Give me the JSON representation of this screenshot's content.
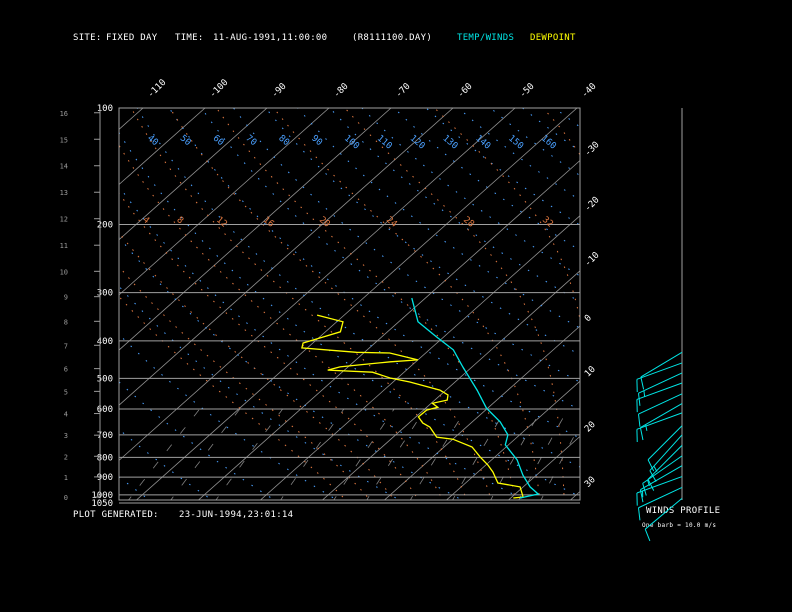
{
  "header": {
    "site_label": "SITE:",
    "site": "FIXED DAY",
    "time_label": "TIME:",
    "time": "11-AUG-1991,11:00:00",
    "file": "(R8111100.DAY)",
    "legend_temp": "TEMP/WINDS",
    "legend_dew": "DEWPOINT"
  },
  "footer": {
    "generated_label": "PLOT GENERATED:",
    "generated": "23-JUN-1994,23:01:14"
  },
  "winds_panel": {
    "title": "WINDS PROFILE",
    "note": "One barb = 10.0 m/s"
  },
  "colors": {
    "background": "#000000",
    "temp": "#00e5e5",
    "dewpoint": "#ffff00",
    "isotherm": "#909090",
    "isobar": "#a0a0a0",
    "dry_adiabat": "#4aa0ff",
    "moist_adiabat": "#e07840",
    "mixing_ratio": "#808080",
    "text": "#ffffff",
    "height_axis": "#9a9a9a"
  },
  "chart_data": {
    "type": "line",
    "diagram": "skew-T log-P",
    "y_scale": "log",
    "ylim_hpa": [
      1050,
      100
    ],
    "pressure_ticks": [
      100,
      200,
      300,
      400,
      500,
      600,
      700,
      800,
      900,
      1000,
      1050
    ],
    "height_ticks_km": [
      0,
      1,
      2,
      3,
      4,
      5,
      6,
      7,
      8,
      9,
      10,
      11,
      12,
      13,
      14,
      15,
      16
    ],
    "isotherm_top_labels": [
      -110,
      -100,
      -90,
      -80,
      -70,
      -60,
      -50,
      -40
    ],
    "isotherm_right_labels": [
      -30,
      -20,
      -10,
      0,
      10,
      20,
      30
    ],
    "dry_adiabat_labels": [
      30,
      40,
      50,
      60,
      70,
      80,
      90,
      100,
      110,
      120,
      130,
      140,
      150,
      160
    ],
    "moist_adiabat_labels": [
      4,
      8,
      12,
      16,
      20,
      24,
      28,
      32
    ],
    "mixing_ratio_lines_gkg": [
      0.1,
      0.2,
      0.4,
      1,
      2,
      3,
      5,
      8,
      12,
      16,
      20
    ],
    "series": [
      {
        "name": "TEMP/WINDS",
        "color": "#00e5e5",
        "points_p_t": [
          [
            310,
            -32.2
          ],
          [
            357,
            -26.9
          ],
          [
            391,
            -21.1
          ],
          [
            422,
            -16.1
          ],
          [
            467,
            -11.5
          ],
          [
            536,
            -5.0
          ],
          [
            597,
            -0.2
          ],
          [
            648,
            4.5
          ],
          [
            700,
            8.1
          ],
          [
            743,
            9.5
          ],
          [
            812,
            14.1
          ],
          [
            889,
            17.8
          ],
          [
            954,
            21.1
          ],
          [
            995,
            23.7
          ],
          [
            1019,
            21.5
          ]
        ]
      },
      {
        "name": "DEWPOINT",
        "color": "#ffff00",
        "points_p_t": [
          [
            343,
            -44.4
          ],
          [
            357,
            -39.0
          ],
          [
            379,
            -37.6
          ],
          [
            391,
            -39.5
          ],
          [
            405,
            -41.6
          ],
          [
            417,
            -40.9
          ],
          [
            428,
            -31.3
          ],
          [
            430,
            -25.8
          ],
          [
            448,
            -20.0
          ],
          [
            453,
            -24.1
          ],
          [
            462,
            -28.9
          ],
          [
            467,
            -31.3
          ],
          [
            476,
            -32.7
          ],
          [
            482,
            -25.1
          ],
          [
            499,
            -21.2
          ],
          [
            511,
            -17.3
          ],
          [
            536,
            -11.0
          ],
          [
            552,
            -8.8
          ],
          [
            569,
            -8.0
          ],
          [
            580,
            -9.8
          ],
          [
            594,
            -8.2
          ],
          [
            604,
            -9.5
          ],
          [
            629,
            -9.6
          ],
          [
            652,
            -7.8
          ],
          [
            668,
            -5.9
          ],
          [
            709,
            -3.0
          ],
          [
            718,
            0.0
          ],
          [
            752,
            4.5
          ],
          [
            798,
            7.6
          ],
          [
            837,
            10.3
          ],
          [
            873,
            12.4
          ],
          [
            932,
            15.2
          ],
          [
            954,
            19.5
          ],
          [
            1013,
            21.8
          ],
          [
            1019,
            20.4
          ]
        ]
      }
    ],
    "winds": [
      {
        "p": 428,
        "dir": 239,
        "speed": 10
      },
      {
        "p": 456,
        "dir": 250,
        "speed": 10
      },
      {
        "p": 484,
        "dir": 245,
        "speed": 15
      },
      {
        "p": 514,
        "dir": 250,
        "speed": 10
      },
      {
        "p": 548,
        "dir": 245,
        "speed": 10
      },
      {
        "p": 581,
        "dir": 240,
        "speed": 15
      },
      {
        "p": 614,
        "dir": 250,
        "speed": 10
      },
      {
        "p": 663,
        "dir": 225,
        "speed": 10
      },
      {
        "p": 700,
        "dir": 222,
        "speed": 15
      },
      {
        "p": 745,
        "dir": 225,
        "speed": 10
      },
      {
        "p": 793,
        "dir": 235,
        "speed": 15
      },
      {
        "p": 841,
        "dir": 240,
        "speed": 10
      },
      {
        "p": 897,
        "dir": 250,
        "speed": 15
      },
      {
        "p": 957,
        "dir": 245,
        "speed": 10
      },
      {
        "p": 1021,
        "dir": 230,
        "speed": 10
      }
    ]
  }
}
